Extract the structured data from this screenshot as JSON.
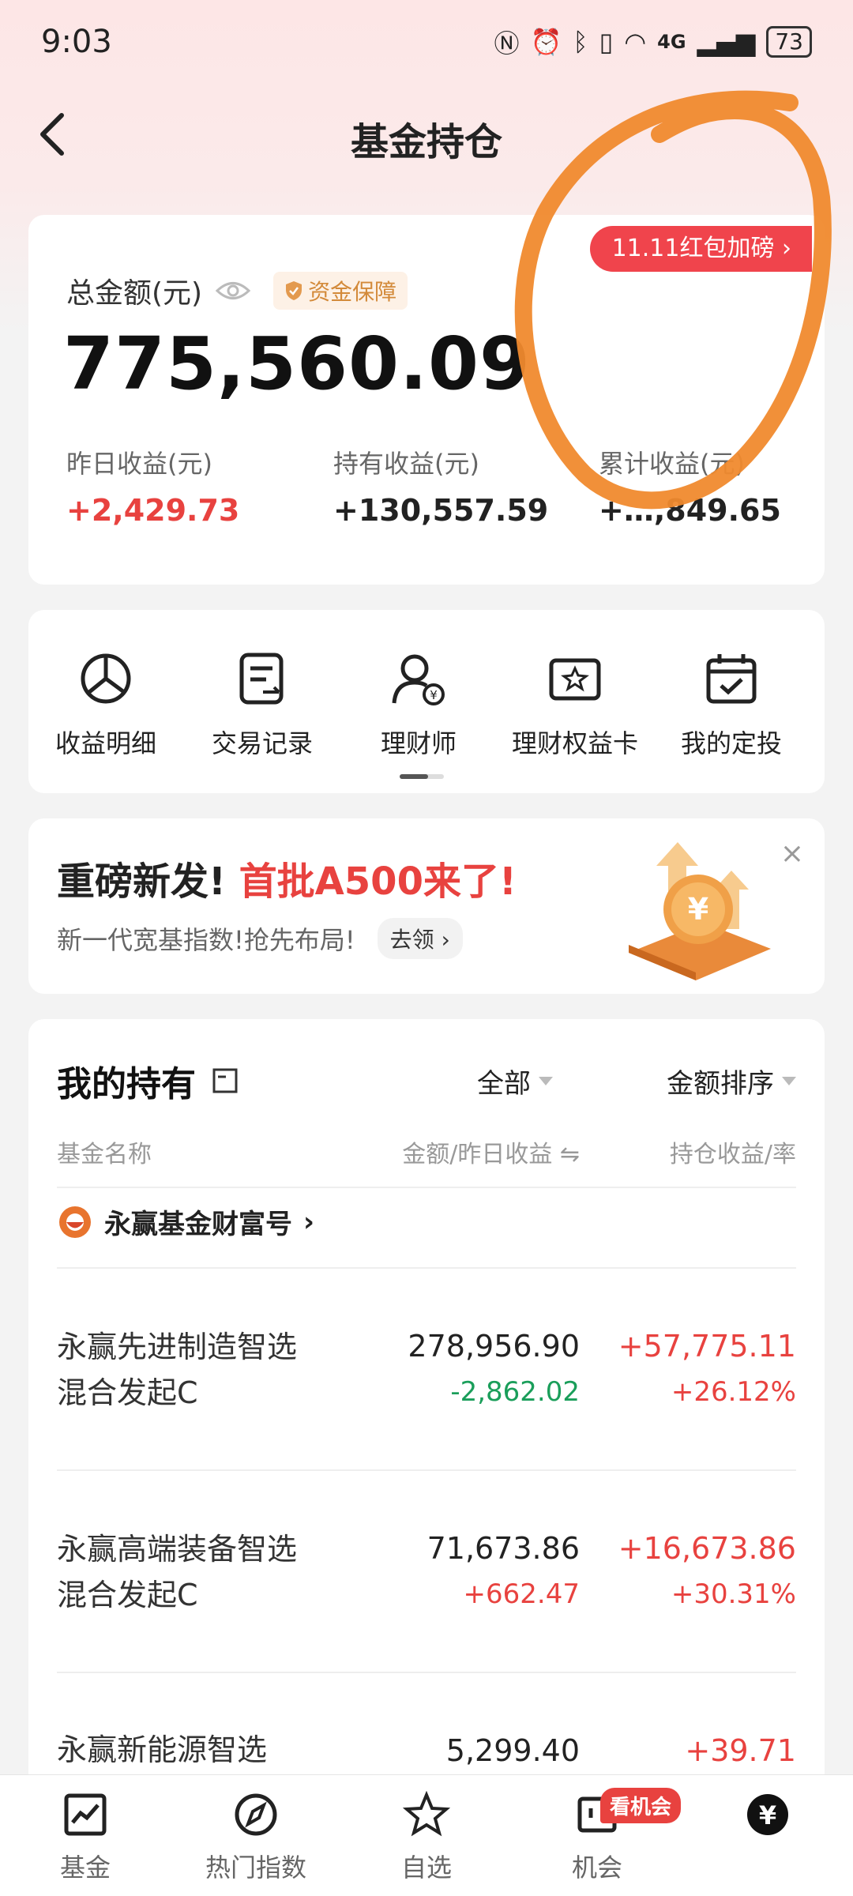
{
  "status_bar": {
    "time": "9:03",
    "signal": "4G",
    "battery": "73"
  },
  "nav": {
    "title": "基金持仓"
  },
  "summary": {
    "promo_tag": "11.11红包加磅",
    "total_label": "总金额(元)",
    "guarantee_badge": "资金保障",
    "total_amount": "775,560.09",
    "stats": [
      {
        "label": "昨日收益(元)",
        "value": "+2,429.73",
        "tone": "red"
      },
      {
        "label": "持有收益(元)",
        "value": "+130,557.59",
        "tone": "dark"
      },
      {
        "label": "累计收益(元)",
        "value": "+…,849.65",
        "tone": "dark"
      }
    ]
  },
  "menu": {
    "items": [
      {
        "label": "收益明细",
        "icon": "pie-chart-icon"
      },
      {
        "label": "交易记录",
        "icon": "record-icon"
      },
      {
        "label": "理财师",
        "icon": "advisor-icon"
      },
      {
        "label": "理财权益卡",
        "icon": "star-card-icon"
      },
      {
        "label": "我的定投",
        "icon": "calendar-check-icon"
      }
    ]
  },
  "banner": {
    "title_main": "重磅新发!",
    "title_highlight": "首批A500来了!",
    "subtitle": "新一代宽基指数!抢先布局!",
    "button_label": "去领",
    "close": "×"
  },
  "holdings": {
    "title": "我的持有",
    "filter_all": "全部",
    "filter_sort": "金额排序",
    "col_name": "基金名称",
    "col_amount": "金额/昨日收益 ⇋",
    "col_profit": "持仓收益/率",
    "brand_label": "永赢基金财富号",
    "funds": [
      {
        "name": "永赢先进制造智选混合发起C",
        "amount": "278,956.90",
        "daily": "-2,862.02",
        "daily_tone": "green",
        "profit": "+57,775.11",
        "rate": "+26.12%"
      },
      {
        "name": "永赢高端装备智选混合发起C",
        "amount": "71,673.86",
        "daily": "+662.47",
        "daily_tone": "red",
        "profit": "+16,673.86",
        "rate": "+30.31%"
      },
      {
        "name": "永赢新能源智选",
        "amount": "5,299.40",
        "daily": "",
        "daily_tone": "red",
        "profit": "+39.71",
        "rate": ""
      }
    ]
  },
  "bottom_nav": {
    "items": [
      {
        "label": "基金",
        "icon": "trend-chart-icon"
      },
      {
        "label": "热门指数",
        "icon": "compass-icon"
      },
      {
        "label": "自选",
        "icon": "star-icon"
      },
      {
        "label": "机会",
        "icon": "opportunity-icon"
      },
      {
        "label": "",
        "icon": "yuan-coin-icon"
      }
    ],
    "badge": "看机会"
  },
  "colors": {
    "accent_red": "#e8423f",
    "gain_green": "#1a9e5a",
    "annotation_orange": "#f08a2e"
  }
}
